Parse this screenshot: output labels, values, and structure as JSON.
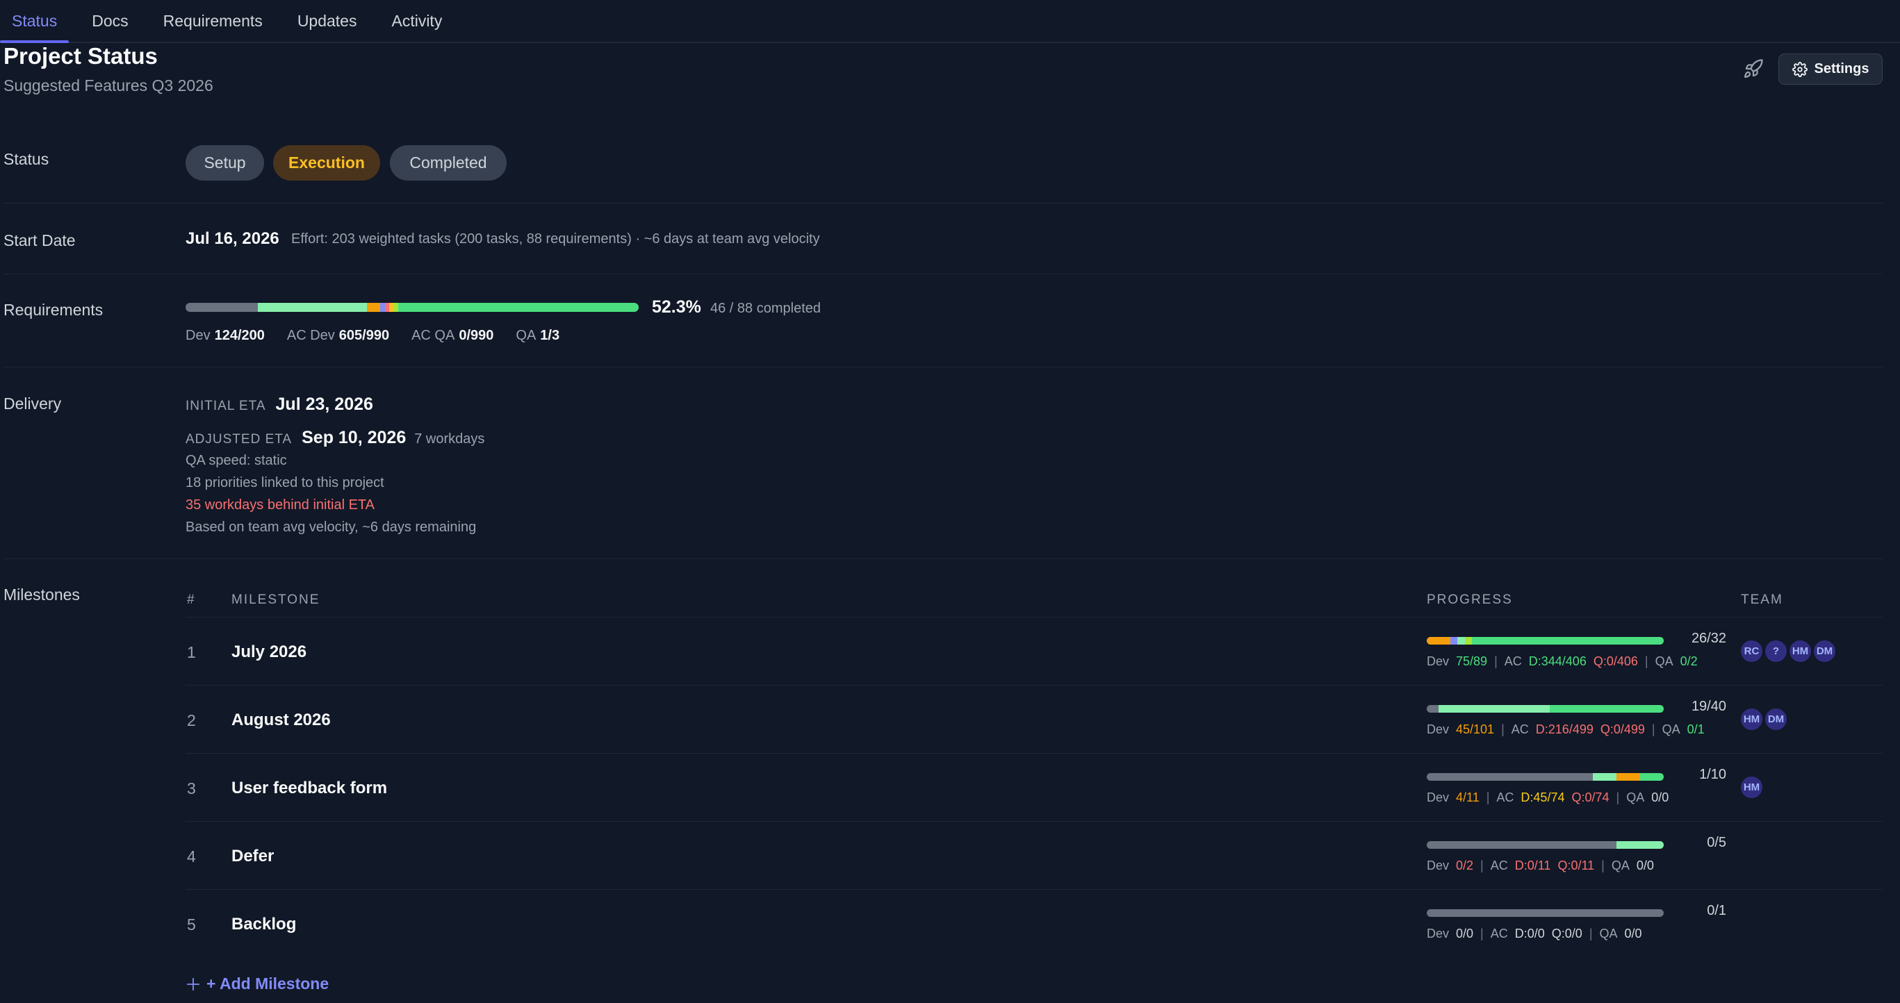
{
  "tabs": [
    {
      "label": "Status",
      "active": true
    },
    {
      "label": "Docs",
      "active": false
    },
    {
      "label": "Requirements",
      "active": false
    },
    {
      "label": "Updates",
      "active": false
    },
    {
      "label": "Activity",
      "active": false
    }
  ],
  "header": {
    "title": "Project Status",
    "subtitle": "Suggested Features Q3 2026",
    "settings_label": "Settings",
    "rocket_icon": "rocket-icon",
    "gear_icon": "gear-icon"
  },
  "status": {
    "label": "Status",
    "options": [
      "Setup",
      "Execution",
      "Completed"
    ],
    "selected": "Execution"
  },
  "start_date": {
    "label": "Start Date",
    "value": "Jul 16, 2026",
    "effort": "Effort: 203 weighted tasks (200 tasks, 88 requirements) · ~6 days at team avg velocity"
  },
  "requirements": {
    "label": "Requirements",
    "percent": "52.3%",
    "count": "46 / 88 completed",
    "stats": [
      {
        "name": "Dev",
        "value": "124/200"
      },
      {
        "name": "AC Dev",
        "value": "605/990"
      },
      {
        "name": "AC QA",
        "value": "0/990"
      },
      {
        "name": "QA",
        "value": "1/3"
      }
    ],
    "bar_segments": [
      {
        "fraction": 0.16,
        "color": "#6b7280"
      },
      {
        "fraction": 0.24,
        "color": "#86efac"
      },
      {
        "fraction": 0.03,
        "color": "#f59e0b"
      },
      {
        "fraction": 0.01,
        "color": "#818cf8"
      },
      {
        "fraction": 0.01,
        "color": "#f87171"
      },
      {
        "fraction": 0.01,
        "color": "#fbbf24"
      },
      {
        "fraction": 0.01,
        "color": "#a3e635"
      },
      {
        "fraction": 0.53,
        "color": "#4ade80"
      }
    ]
  },
  "delivery": {
    "label": "Delivery",
    "initial_eta_label": "INITIAL ETA",
    "initial_eta": "Jul 23, 2026",
    "adjusted_eta_label": "ADJUSTED ETA",
    "adjusted_eta": "Sep 10, 2026",
    "adjusted_note": "7 workdays",
    "qa_speed": "QA speed: static",
    "priorities": "18 priorities linked to this project",
    "behind": "35 workdays behind initial ETA",
    "velocity_note": "Based on team avg velocity, ~6 days remaining"
  },
  "milestones": {
    "label": "Milestones",
    "headers": {
      "num": "#",
      "milestone": "MILESTONE",
      "progress": "PROGRESS",
      "team": "TEAM"
    },
    "add_label": "+ Add Milestone",
    "rows": [
      {
        "num": "1",
        "name": "July 2026",
        "count": "26/32",
        "dev": "75/89",
        "dev_color": "green",
        "ac_d": "D:344/406",
        "ac_d_color": "green",
        "ac_q": "Q:0/406",
        "ac_q_color": "red",
        "qa": "0/2",
        "qa_color": "green",
        "team": [
          "RC",
          "?",
          "HM",
          "DM"
        ],
        "segments": [
          {
            "fraction": 0.1,
            "color": "#f59e0b"
          },
          {
            "fraction": 0.03,
            "color": "#818cf8"
          },
          {
            "fraction": 0.03,
            "color": "#86efac"
          },
          {
            "fraction": 0.03,
            "color": "#a3e635"
          },
          {
            "fraction": 0.81,
            "color": "#4ade80"
          }
        ]
      },
      {
        "num": "2",
        "name": "August 2026",
        "count": "19/40",
        "dev": "45/101",
        "dev_color": "orange",
        "ac_d": "D:216/499",
        "ac_d_color": "red",
        "ac_q": "Q:0/499",
        "ac_q_color": "red",
        "qa": "0/1",
        "qa_color": "green",
        "team": [
          "HM",
          "DM"
        ],
        "segments": [
          {
            "fraction": 0.05,
            "color": "#6b7280"
          },
          {
            "fraction": 0.47,
            "color": "#86efac"
          },
          {
            "fraction": 0.48,
            "color": "#4ade80"
          }
        ]
      },
      {
        "num": "3",
        "name": "User feedback form",
        "count": "1/10",
        "dev": "4/11",
        "dev_color": "orange",
        "ac_d": "D:45/74",
        "ac_d_color": "yellow",
        "ac_q": "Q:0/74",
        "ac_q_color": "red",
        "qa": "0/0",
        "qa_color": "gray",
        "team": [
          "HM"
        ],
        "segments": [
          {
            "fraction": 0.7,
            "color": "#6b7280"
          },
          {
            "fraction": 0.1,
            "color": "#86efac"
          },
          {
            "fraction": 0.1,
            "color": "#f59e0b"
          },
          {
            "fraction": 0.1,
            "color": "#4ade80"
          }
        ]
      },
      {
        "num": "4",
        "name": "Defer",
        "count": "0/5",
        "dev": "0/2",
        "dev_color": "red",
        "ac_d": "D:0/11",
        "ac_d_color": "red",
        "ac_q": "Q:0/11",
        "ac_q_color": "red",
        "qa": "0/0",
        "qa_color": "gray",
        "team": [],
        "segments": [
          {
            "fraction": 0.8,
            "color": "#6b7280"
          },
          {
            "fraction": 0.2,
            "color": "#86efac"
          }
        ]
      },
      {
        "num": "5",
        "name": "Backlog",
        "count": "0/1",
        "dev": "0/0",
        "dev_color": "gray",
        "ac_d": "D:0/0",
        "ac_d_color": "gray",
        "ac_q": "Q:0/0",
        "ac_q_color": "gray",
        "qa": "0/0",
        "qa_color": "gray",
        "team": [],
        "segments": [
          {
            "fraction": 1.0,
            "color": "#6b7280"
          }
        ]
      }
    ]
  }
}
